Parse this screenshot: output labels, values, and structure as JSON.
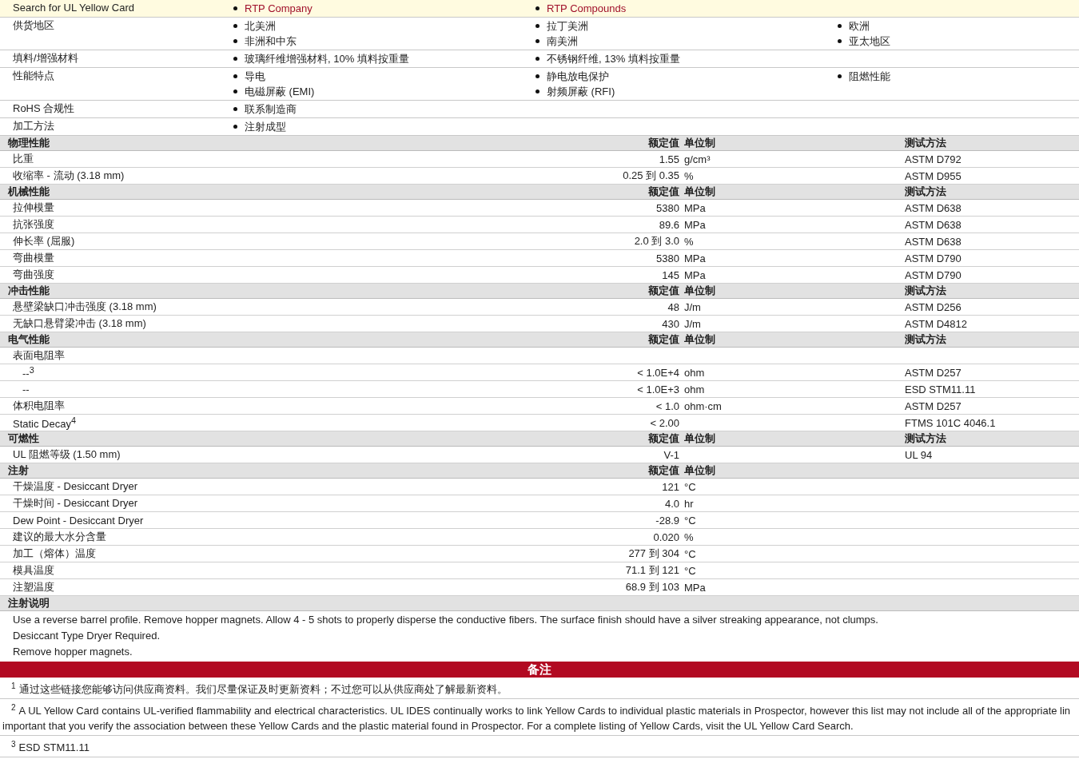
{
  "top_row": {
    "label": "Search for UL Yellow Card",
    "links": [
      "RTP Company",
      "RTP Compounds"
    ]
  },
  "general": [
    {
      "label": "供货地区",
      "columns": [
        [
          "北美洲",
          "非洲和中东"
        ],
        [
          "拉丁美洲",
          "南美洲"
        ],
        [
          "欧洲",
          "亚太地区"
        ]
      ]
    },
    {
      "label": "填料/增强材料",
      "columns": [
        [
          "玻璃纤维增强材料, 10% 填料按重量"
        ],
        [
          "不锈钢纤维, 13% 填料按重量"
        ]
      ]
    },
    {
      "label": "性能特点",
      "columns": [
        [
          "导电",
          "电磁屏蔽 (EMI)"
        ],
        [
          "静电放电保护",
          "射频屏蔽 (RFI)"
        ],
        [
          "阻燃性能"
        ]
      ]
    },
    {
      "label": "RoHS 合规性",
      "columns": [
        [
          "联系制造商"
        ]
      ]
    },
    {
      "label": "加工方法",
      "columns": [
        [
          "注射成型"
        ]
      ]
    }
  ],
  "sections": [
    {
      "title": "物理性能",
      "value_header": "额定值",
      "unit_header": "单位制",
      "method_header": "测试方法",
      "rows": [
        {
          "kind": "property",
          "name": "比重",
          "value": "1.55",
          "unit": "g/cm³",
          "method": "ASTM D792"
        },
        {
          "kind": "property",
          "name": "收缩率  - 流动  (3.18 mm)",
          "value": "0.25 到  0.35",
          "unit": "%",
          "method": "ASTM D955"
        }
      ]
    },
    {
      "title": "机械性能",
      "value_header": "额定值",
      "unit_header": "单位制",
      "method_header": "测试方法",
      "rows": [
        {
          "kind": "property",
          "name": "拉伸模量",
          "value": "5380",
          "unit": "MPa",
          "method": "ASTM D638"
        },
        {
          "kind": "property",
          "name": "抗张强度",
          "value": "89.6",
          "unit": "MPa",
          "method": "ASTM D638"
        },
        {
          "kind": "property",
          "name": "伸长率  (屈服)",
          "value": "2.0 到  3.0",
          "unit": "%",
          "method": "ASTM D638"
        },
        {
          "kind": "property",
          "name": "弯曲模量",
          "value": "5380",
          "unit": "MPa",
          "method": "ASTM D790"
        },
        {
          "kind": "property",
          "name": "弯曲强度",
          "value": "145",
          "unit": "MPa",
          "method": "ASTM D790"
        }
      ]
    },
    {
      "title": "冲击性能",
      "value_header": "额定值",
      "unit_header": "单位制",
      "method_header": "测试方法",
      "rows": [
        {
          "kind": "property",
          "name": "悬壁梁缺口冲击强度  (3.18 mm)",
          "value": "48",
          "unit": "J/m",
          "method": "ASTM D256"
        },
        {
          "kind": "property",
          "name": "无缺口悬臂梁冲击  (3.18 mm)",
          "value": "430",
          "unit": "J/m",
          "method": "ASTM D4812"
        }
      ]
    },
    {
      "title": "电气性能",
      "value_header": "额定值",
      "unit_header": "单位制",
      "method_header": "测试方法",
      "rows": [
        {
          "kind": "group",
          "name": "表面电阻率"
        },
        {
          "kind": "sub",
          "name": "--$^{3}$",
          "value": "< 1.0E+4",
          "unit": "ohm",
          "method": "ASTM D257"
        },
        {
          "kind": "sub",
          "name": "--",
          "value": "< 1.0E+3",
          "unit": "ohm",
          "method": "ESD STM11.11"
        },
        {
          "kind": "property",
          "name": "体积电阻率",
          "value": "< 1.0",
          "unit": "ohm·cm",
          "method": "ASTM D257"
        },
        {
          "kind": "property",
          "name": "Static Decay$^{4}$",
          "value": "< 2.00",
          "method": "FTMS 101C 4046.1"
        }
      ]
    },
    {
      "title": "可燃性",
      "value_header": "额定值",
      "unit_header": "单位制",
      "method_header": "测试方法",
      "rows": [
        {
          "kind": "property",
          "name": "UL 阻燃等级  (1.50 mm)",
          "value": "V-1",
          "method": "UL 94"
        }
      ]
    },
    {
      "title": "注射",
      "value_header": "额定值",
      "unit_header": "单位制",
      "rows": [
        {
          "kind": "property",
          "name": "干燥温度  - Desiccant Dryer",
          "value": "121",
          "unit": "°C"
        },
        {
          "kind": "property",
          "name": "干燥时间  - Desiccant Dryer",
          "value": "4.0",
          "unit": "hr"
        },
        {
          "kind": "property",
          "name": "Dew Point - Desiccant Dryer",
          "value": "-28.9",
          "unit": "°C"
        },
        {
          "kind": "property",
          "name": "建议的最大水分含量",
          "value": "0.020",
          "unit": "%"
        },
        {
          "kind": "property",
          "name": "加工（熔体）温度",
          "value": "277 到  304",
          "unit": "°C"
        },
        {
          "kind": "property",
          "name": "模具温度",
          "value": "71.1 到  121",
          "unit": "°C"
        },
        {
          "kind": "property",
          "name": "注塑温度",
          "value": "68.9 到  103",
          "unit": "MPa"
        }
      ]
    }
  ],
  "notes": {
    "title": "注射说明",
    "lines": [
      "Use a reverse barrel profile. Remove hopper magnets. Allow 4 - 5 shots to properly disperse the conductive fibers. The surface finish should have a silver streaking appearance, not clumps.",
      "Desiccant Type Dryer Required.",
      "Remove hopper magnets."
    ]
  },
  "remarks": {
    "title": "备注",
    "footnotes": [
      {
        "mark": "1",
        "lines": [
          "通过这些链接您能够访问供应商资料。我们尽量保证及时更新资料；不过您可以从供应商处了解最新资料。"
        ]
      },
      {
        "mark": "2",
        "lines": [
          "A UL Yellow Card contains UL-verified flammability and electrical characteristics. UL IDES continually works to link Yellow Cards to individual plastic materials in Prospector, however this list may not include all of the appropriate lin",
          "important that you verify the association between these Yellow Cards and the plastic material found in Prospector. For a complete listing of Yellow Cards, visit the UL Yellow Card Search."
        ]
      },
      {
        "mark": "3",
        "lines": [
          "ESD STM11.11"
        ]
      }
    ]
  }
}
